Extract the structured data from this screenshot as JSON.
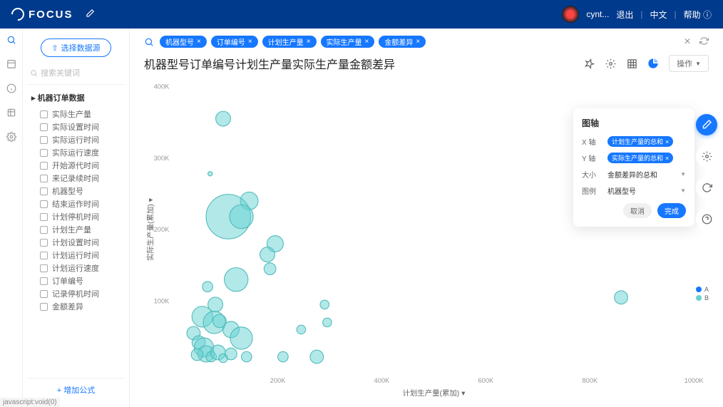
{
  "header": {
    "logo": "FOCUS",
    "username": "cynt...",
    "logout": "退出",
    "lang": "中文",
    "help": "帮助"
  },
  "sidebar": {
    "select_source_btn": "选择数据源",
    "search_placeholder": "搜索关键词",
    "tree_root": "机器订单数据",
    "items": [
      {
        "label": "实际生产量"
      },
      {
        "label": "实际设置时间"
      },
      {
        "label": "实际运行时间"
      },
      {
        "label": "实际运行速度"
      },
      {
        "label": "开始源代时间"
      },
      {
        "label": "来记录续时间"
      },
      {
        "label": "机器型号"
      },
      {
        "label": "结束运作时间"
      },
      {
        "label": "计划停机时间"
      },
      {
        "label": "计划生产量"
      },
      {
        "label": "计划设置时间"
      },
      {
        "label": "计划运行时间"
      },
      {
        "label": "计划运行速度"
      },
      {
        "label": "订单编号"
      },
      {
        "label": "记录停机时间"
      },
      {
        "label": "金额差异"
      }
    ],
    "add_formula": "+ 增加公式"
  },
  "search": {
    "tags": [
      "机器型号",
      "订单编号",
      "计划生产量",
      "实际生产量",
      "金额差异"
    ]
  },
  "title": "机器型号订单编号计划生产量实际生产量金额差异",
  "ops_label": "操作",
  "config": {
    "title": "图轴",
    "x_label": "X 轴",
    "x_chip": "计划生产量的总和",
    "y_label": "Y 轴",
    "y_chip": "实际生产量的总和",
    "size_label": "大小",
    "size_value": "金额差异的总和",
    "legend_label": "图例",
    "legend_value": "机器型号",
    "cancel": "取消",
    "ok": "完成"
  },
  "legend": {
    "items": [
      {
        "label": "A",
        "color": "#1677ff"
      },
      {
        "label": "B",
        "color": "#66d1d1"
      }
    ]
  },
  "status": "javascript:void(0)",
  "chart_data": {
    "type": "scatter",
    "xlabel": "计划生产量(累加)",
    "ylabel": "实际生产量(累加)",
    "xlim": [
      0,
      1000000
    ],
    "ylim": [
      0,
      400000
    ],
    "x_ticks": [
      200000,
      400000,
      600000,
      800000,
      1000000
    ],
    "y_ticks": [
      100000,
      200000,
      300000,
      400000
    ],
    "x_tick_labels": [
      "200K",
      "400K",
      "600K",
      "800K",
      "1000K"
    ],
    "y_tick_labels": [
      "100K",
      "200K",
      "300K",
      "400K"
    ],
    "points": [
      {
        "x": 95000,
        "y": 355000,
        "r": 10,
        "s": "B"
      },
      {
        "x": 145000,
        "y": 240000,
        "r": 12,
        "s": "B"
      },
      {
        "x": 105000,
        "y": 218000,
        "r": 30,
        "s": "B"
      },
      {
        "x": 130000,
        "y": 218000,
        "r": 16,
        "s": "B"
      },
      {
        "x": 70000,
        "y": 278000,
        "r": 3,
        "s": "B"
      },
      {
        "x": 195000,
        "y": 180000,
        "r": 11,
        "s": "B"
      },
      {
        "x": 180000,
        "y": 165000,
        "r": 10,
        "s": "B"
      },
      {
        "x": 185000,
        "y": 145000,
        "r": 8,
        "s": "B"
      },
      {
        "x": 120000,
        "y": 130000,
        "r": 16,
        "s": "B"
      },
      {
        "x": 65000,
        "y": 120000,
        "r": 7,
        "s": "B"
      },
      {
        "x": 80000,
        "y": 95000,
        "r": 10,
        "s": "B"
      },
      {
        "x": 55000,
        "y": 78000,
        "r": 14,
        "s": "B"
      },
      {
        "x": 78000,
        "y": 70000,
        "r": 15,
        "s": "B"
      },
      {
        "x": 88000,
        "y": 72000,
        "r": 9,
        "s": "A"
      },
      {
        "x": 110000,
        "y": 60000,
        "r": 11,
        "s": "B"
      },
      {
        "x": 130000,
        "y": 48000,
        "r": 15,
        "s": "B"
      },
      {
        "x": 38000,
        "y": 55000,
        "r": 9,
        "s": "B"
      },
      {
        "x": 48000,
        "y": 42000,
        "r": 9,
        "s": "B"
      },
      {
        "x": 58000,
        "y": 35000,
        "r": 13,
        "s": "B"
      },
      {
        "x": 62000,
        "y": 26000,
        "r": 11,
        "s": "B"
      },
      {
        "x": 45000,
        "y": 25000,
        "r": 8,
        "s": "B"
      },
      {
        "x": 72000,
        "y": 22000,
        "r": 7,
        "s": "B"
      },
      {
        "x": 85000,
        "y": 28000,
        "r": 10,
        "s": "B"
      },
      {
        "x": 95000,
        "y": 20000,
        "r": 6,
        "s": "B"
      },
      {
        "x": 110000,
        "y": 26000,
        "r": 8,
        "s": "B"
      },
      {
        "x": 140000,
        "y": 22000,
        "r": 7,
        "s": "B"
      },
      {
        "x": 210000,
        "y": 22000,
        "r": 7,
        "s": "B"
      },
      {
        "x": 275000,
        "y": 22000,
        "r": 9,
        "s": "B"
      },
      {
        "x": 290000,
        "y": 95000,
        "r": 6,
        "s": "B"
      },
      {
        "x": 295000,
        "y": 70000,
        "r": 6,
        "s": "B"
      },
      {
        "x": 245000,
        "y": 60000,
        "r": 6,
        "s": "B"
      },
      {
        "x": 860000,
        "y": 105000,
        "r": 9,
        "s": "B"
      }
    ]
  }
}
